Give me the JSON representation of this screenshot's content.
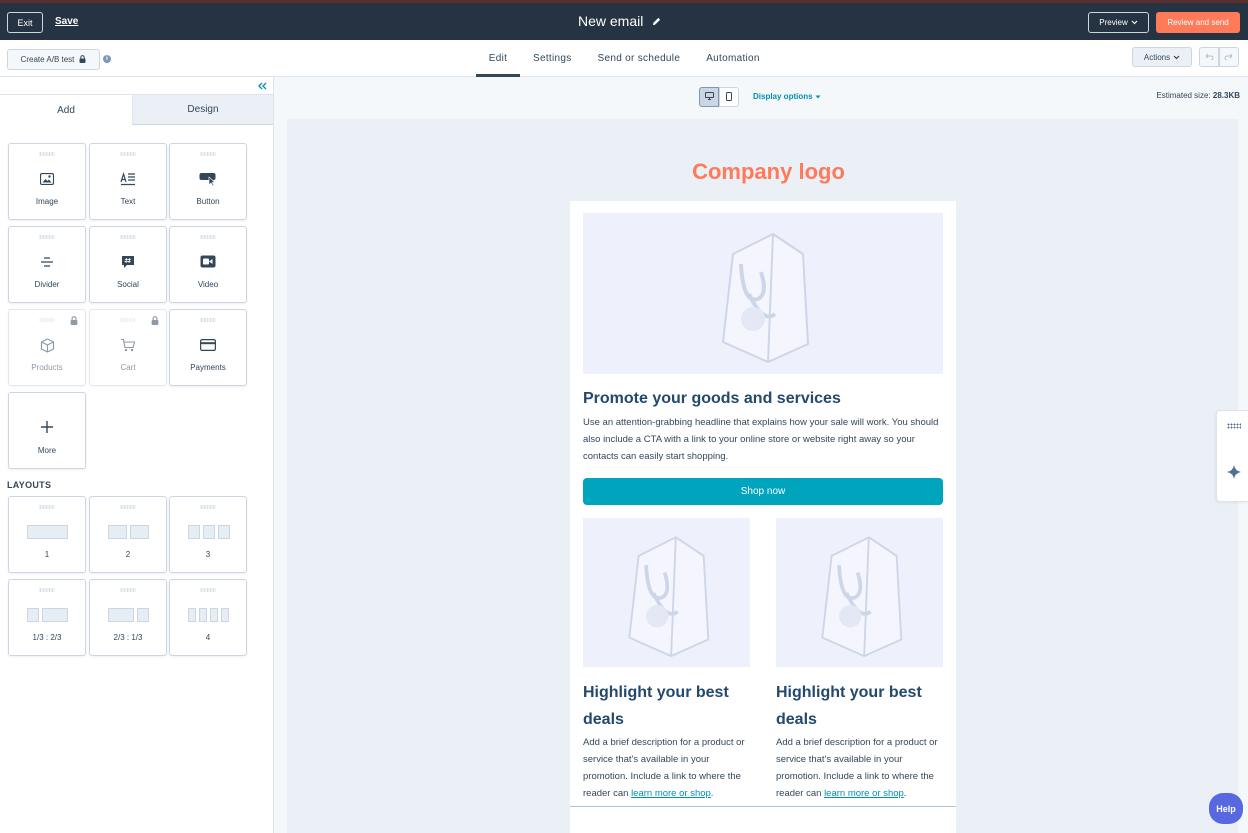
{
  "topbar": {
    "exit_label": "Exit",
    "save_label": "Save",
    "title": "New email",
    "preview_label": "Preview",
    "review_label": "Review and send"
  },
  "subbar": {
    "ab_test_label": "Create A/B test",
    "tabs": [
      {
        "label": "Edit",
        "active": true
      },
      {
        "label": "Settings",
        "active": false
      },
      {
        "label": "Send or schedule",
        "active": false
      },
      {
        "label": "Automation",
        "active": false
      }
    ],
    "actions_label": "Actions"
  },
  "leftpanel": {
    "tabs": {
      "add": "Add",
      "design": "Design"
    },
    "modules": [
      {
        "label": "Image",
        "icon": "image-icon",
        "locked": false
      },
      {
        "label": "Text",
        "icon": "text-icon",
        "locked": false
      },
      {
        "label": "Button",
        "icon": "button-icon",
        "locked": false
      },
      {
        "label": "Divider",
        "icon": "divider-icon",
        "locked": false
      },
      {
        "label": "Social",
        "icon": "social-icon",
        "locked": false
      },
      {
        "label": "Video",
        "icon": "video-icon",
        "locked": false
      },
      {
        "label": "Products",
        "icon": "products-icon",
        "locked": true
      },
      {
        "label": "Cart",
        "icon": "cart-icon",
        "locked": true
      },
      {
        "label": "Payments",
        "icon": "payments-icon",
        "locked": false
      },
      {
        "label": "More",
        "icon": "plus-icon",
        "locked": false
      }
    ],
    "layouts_title": "LAYOUTS",
    "layouts": [
      {
        "label": "1"
      },
      {
        "label": "2"
      },
      {
        "label": "3"
      },
      {
        "label": "1/3 : 2/3"
      },
      {
        "label": "2/3 : 1/3"
      },
      {
        "label": "4"
      }
    ]
  },
  "canvas": {
    "display_options_label": "Display options",
    "estimated_size_label": "Estimated size:",
    "estimated_size_value": "28.3KB",
    "email": {
      "logo_text": "Company logo",
      "headline": "Promote your goods and services",
      "body": "Use an attention-grabbing headline that explains how your sale will work. You should also include a CTA with a link to your online store or website right away so your contacts can easily start shopping.",
      "cta_label": "Shop now",
      "columns": [
        {
          "heading": "Highlight your best deals",
          "text": "Add a brief description for a product or service that's available in your promotion. Include a link to where the reader can",
          "link": "learn more or shop",
          "end": "."
        },
        {
          "heading": "Highlight your best deals",
          "text": "Add a brief description for a product or service that's available in your promotion. Include a link to where the reader can",
          "link": "learn more or shop",
          "end": "."
        }
      ]
    }
  },
  "help_label": "Help",
  "colors": {
    "topbar": "#253342",
    "accent_orange": "#ff7a59",
    "cta_teal": "#00a4bd",
    "heading_blue": "#23496d",
    "help_purple": "#5768e0"
  }
}
